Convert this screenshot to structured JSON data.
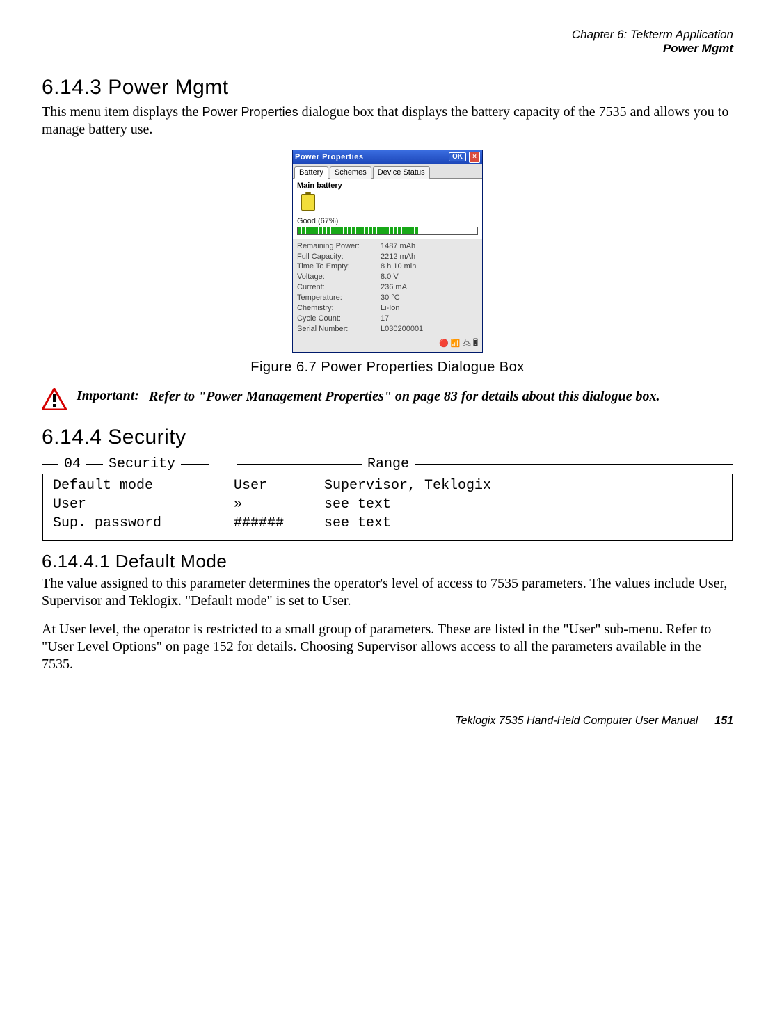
{
  "header": {
    "chapter": "Chapter 6: Tekterm Application",
    "section": "Power Mgmt"
  },
  "s6143": {
    "title": "6.14.3  Power Mgmt",
    "p1a": "This menu item displays the ",
    "p1b": "Power Properties",
    "p1c": " dialogue box that displays the battery capacity of the 7535 and allows you to manage battery use."
  },
  "power_properties": {
    "title": "Power Properties",
    "ok": "OK",
    "close": "×",
    "tabs": {
      "battery": "Battery",
      "schemes": "Schemes",
      "device": "Device Status"
    },
    "main_label": "Main battery",
    "charge_text": "Good  (67%)",
    "charge_pct": 67,
    "stats": [
      {
        "k": "Remaining Power:",
        "v": "1487 mAh"
      },
      {
        "k": "Full Capacity:",
        "v": "2212 mAh"
      },
      {
        "k": "Time To Empty:",
        "v": "8 h 10 min"
      },
      {
        "k": "Voltage:",
        "v": "8.0 V"
      },
      {
        "k": "Current:",
        "v": "236 mA"
      },
      {
        "k": "Temperature:",
        "v": "30 °C"
      },
      {
        "k": "Chemistry:",
        "v": "Li-Ion"
      },
      {
        "k": "Cycle Count:",
        "v": "17"
      },
      {
        "k": "Serial Number:",
        "v": "L030200001"
      }
    ],
    "tray": "🔴 📶 🖧 🖥"
  },
  "fig67": "Figure 6.7 Power Properties Dialogue Box",
  "important": {
    "label": "Important:",
    "text": "Refer to \"Power Management Properties\" on page 83 for details about this dialogue box."
  },
  "s6144": {
    "title": "6.14.4  Security"
  },
  "security_box": {
    "page_num": "04",
    "title": "Security",
    "range": "Range",
    "rows": [
      {
        "name": "Default mode",
        "val": "User",
        "range": "Supervisor, Teklogix"
      },
      {
        "name": "User",
        "val": "»",
        "range": "see text"
      },
      {
        "name": "Sup. password",
        "val": "######",
        "range": "see text"
      }
    ]
  },
  "s61441": {
    "title": "6.14.4.1  Default Mode",
    "p1": "The value assigned to this parameter determines the operator's level of access to 7535 parameters. The values include User, Supervisor and Teklogix. \"Default mode\" is set to User.",
    "p2": "At User level, the operator is restricted to a small group of parameters. These are listed in the \"User\" sub-menu. Refer to \"User Level Options\" on page 152 for details. Choosing Supervisor allows access to all the parameters available in the 7535."
  },
  "footer": {
    "manual": "Teklogix 7535 Hand-Held Computer User Manual",
    "page": "151"
  }
}
